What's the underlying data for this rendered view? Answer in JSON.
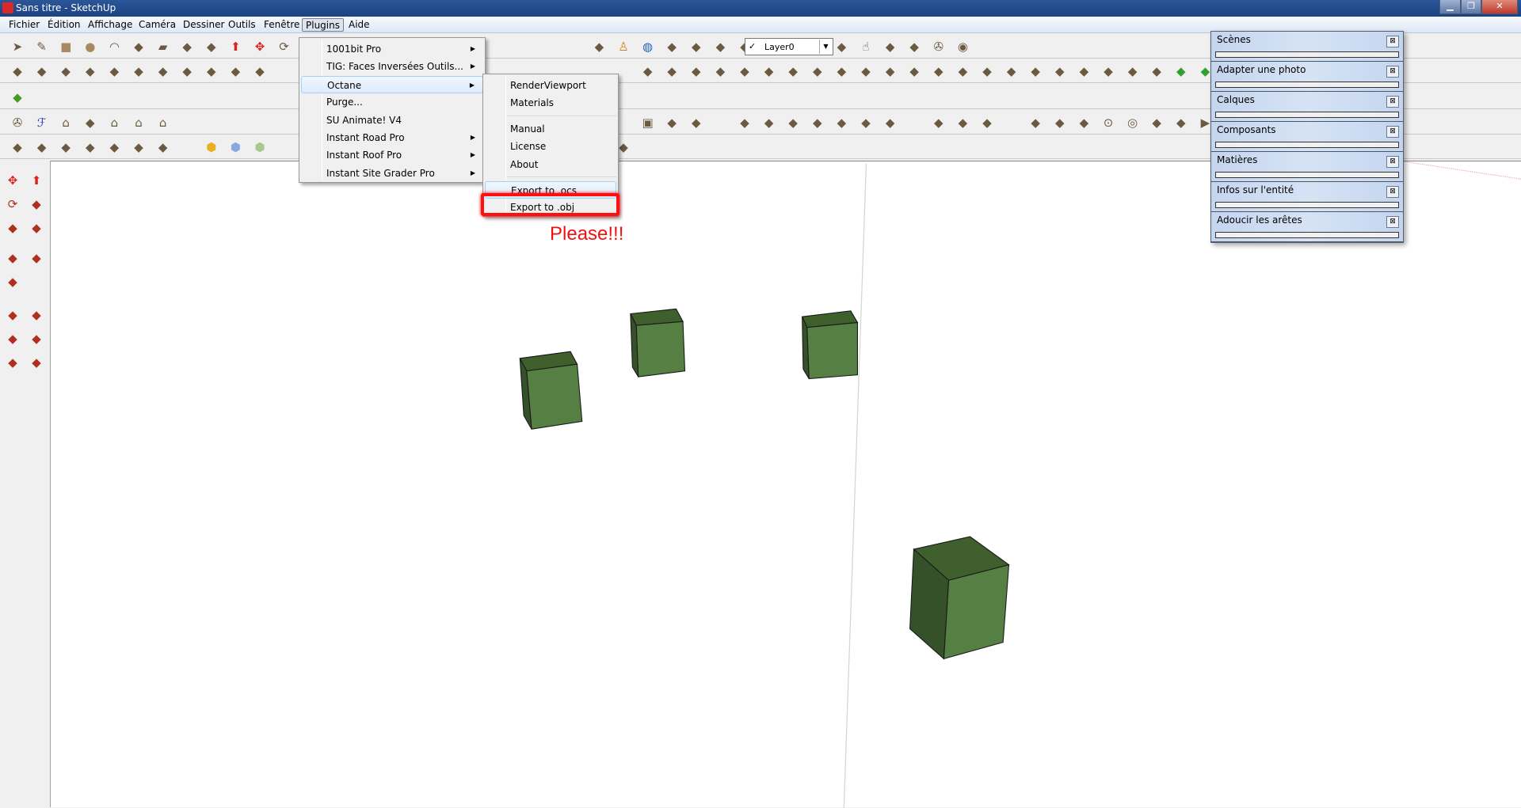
{
  "window": {
    "title": "Sans titre - SketchUp",
    "controls": [
      "minimize",
      "maximize",
      "close"
    ]
  },
  "menubar": [
    "Fichier",
    "Édition",
    "Affichage",
    "Caméra",
    "Dessiner",
    "Outils",
    "Fenêtre",
    "Plugins",
    "Aide"
  ],
  "toolbar": {
    "layer_select": "Layer0",
    "layer_check": "✓",
    "rows": [
      [
        "select",
        "pencil",
        "rectangle",
        "circle",
        "arc",
        "eraser-outline",
        "eraser",
        "tape-measure",
        "paint-bucket",
        "push-pull",
        "move",
        "rotate",
        "",
        "",
        "",
        "",
        "",
        "",
        "",
        "",
        "",
        "",
        "",
        "",
        "warehouse-model",
        "person",
        "google-earth",
        "download-model",
        "upload-model",
        "share-model",
        "sandbox",
        "sandbox-2",
        "sandbox-3",
        "",
        "layer-info",
        "hand",
        "component-box",
        "paper",
        "octane",
        "wheel"
      ],
      [
        "axes",
        "section",
        "circle-plus",
        "curve-dots",
        "flip",
        "layers-stack",
        "layers-color",
        "intersect",
        "octagon",
        "faces",
        "pipe",
        "",
        "",
        "",
        "",
        "",
        "",
        "",
        "",
        "",
        "",
        "",
        "",
        "",
        "",
        "",
        "roof",
        "window",
        "pillar",
        "hand-glove",
        "stairs",
        "wall",
        "wall-2",
        "siding",
        "post",
        "arrow-down",
        "cut",
        "steps",
        "ramp",
        "frame",
        "arch",
        "grid",
        "grid-2",
        "hatch",
        "lattice",
        "shingle",
        "ramp-2",
        "slope",
        "terrain",
        "contour",
        "contour-2"
      ],
      [
        "sandbox-grid"
      ],
      [
        "octane",
        "f6",
        "house",
        "door",
        "house-2",
        "house-3",
        "house-4",
        "",
        "",
        "",
        "",
        "",
        "",
        "",
        "",
        "",
        "",
        "",
        "",
        "",
        "",
        "",
        "",
        "",
        "",
        "",
        "box",
        "box-stripes",
        "box-blue",
        "",
        "push-pull-menu",
        "push-pull-j",
        "push-pull-r",
        "push-pull-v",
        "push-pull-n",
        "push-pull-x",
        "push-pull-f",
        "",
        "shell",
        "pendulum",
        "mesh",
        "",
        "pin",
        "bezier",
        "bezier-2",
        "circle-center",
        "concentric",
        "spline",
        "spline-2",
        "play",
        "clipboard"
      ],
      [
        "texture",
        "texture-2",
        "texture-3",
        "texture-4",
        "texture-5",
        "texture-6",
        "texture-7",
        "",
        "cube-yellow",
        "cube-blue",
        "cube-green",
        "",
        "paper-curl",
        "",
        "",
        "",
        "",
        "",
        "",
        "",
        "",
        "",
        "",
        "",
        "",
        "paint-pink"
      ]
    ],
    "left": [
      "move",
      "push-pull",
      "rotate",
      "follow-me",
      "scale",
      "offset",
      "orbit",
      "section-plane",
      "section-view",
      "tape-measure",
      "axes-tool",
      "protractor",
      "text-label",
      "axes",
      "3d-text"
    ]
  },
  "plugins_menu": {
    "items": [
      {
        "label": "1001bit Pro",
        "submenu": true
      },
      {
        "label": "TIG: Faces Inversées Outils...",
        "submenu": true
      },
      {
        "label": "Octane",
        "submenu": true,
        "highlighted": true
      },
      {
        "label": "Purge...",
        "submenu": false
      },
      {
        "label": "SU Animate! V4",
        "submenu": false
      },
      {
        "label": "Instant Road Pro",
        "submenu": true
      },
      {
        "label": "Instant Roof Pro",
        "submenu": true
      },
      {
        "label": "Instant Site Grader Pro",
        "submenu": true
      }
    ]
  },
  "octane_menu": {
    "items": [
      {
        "label": "RenderViewport"
      },
      {
        "label": "Materials"
      },
      {
        "sep": true
      },
      {
        "label": "Manual"
      },
      {
        "label": "License"
      },
      {
        "label": "About"
      },
      {
        "sep": true
      },
      {
        "label": "Export to .ocs",
        "highlighted": true
      },
      {
        "label": "Export to .obj",
        "marked": true
      }
    ]
  },
  "annotation": {
    "text": "Please!!!",
    "color": "#f01010"
  },
  "panels": [
    "Scènes",
    "Adapter une photo",
    "Calques",
    "Composants",
    "Matières",
    "Infos sur l'entité",
    "Adoucir les arêtes"
  ],
  "colors": {
    "cube_top": "#3f5f2c",
    "cube_left": "#35512a",
    "cube_right": "#567f43",
    "edges": "#1a1a1a"
  }
}
